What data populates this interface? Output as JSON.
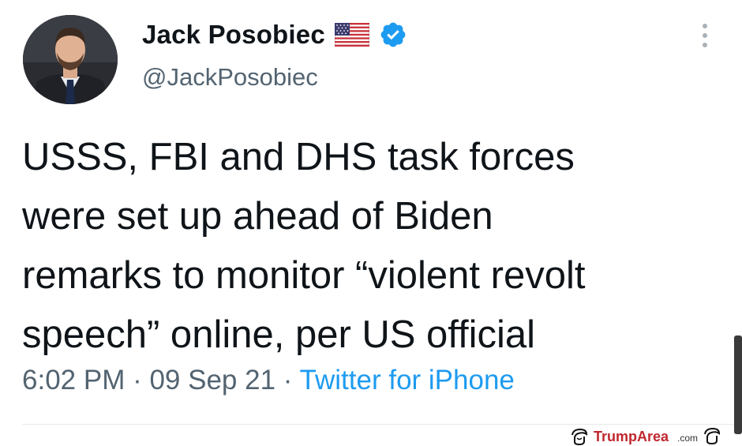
{
  "tweet": {
    "author": {
      "display_name": "Jack Posobiec",
      "handle": "@JackPosobiec",
      "flag_icon": "us-flag-icon",
      "verified_icon": "verified-badge-icon",
      "verified_color": "#1d9bf0"
    },
    "text_lines": [
      "USSS, FBI and DHS task forces",
      "were set up ahead of Biden",
      "remarks to monitor “violent revolt",
      "speech” online, per US official"
    ],
    "meta": {
      "time": "6:02 PM",
      "separator": " · ",
      "date": "09 Sep 21",
      "source": "Twitter for iPhone"
    },
    "menu_icon": "more-vertical-icon"
  },
  "watermark": {
    "text": "TrumpArea.com",
    "color": "#c0272d"
  }
}
